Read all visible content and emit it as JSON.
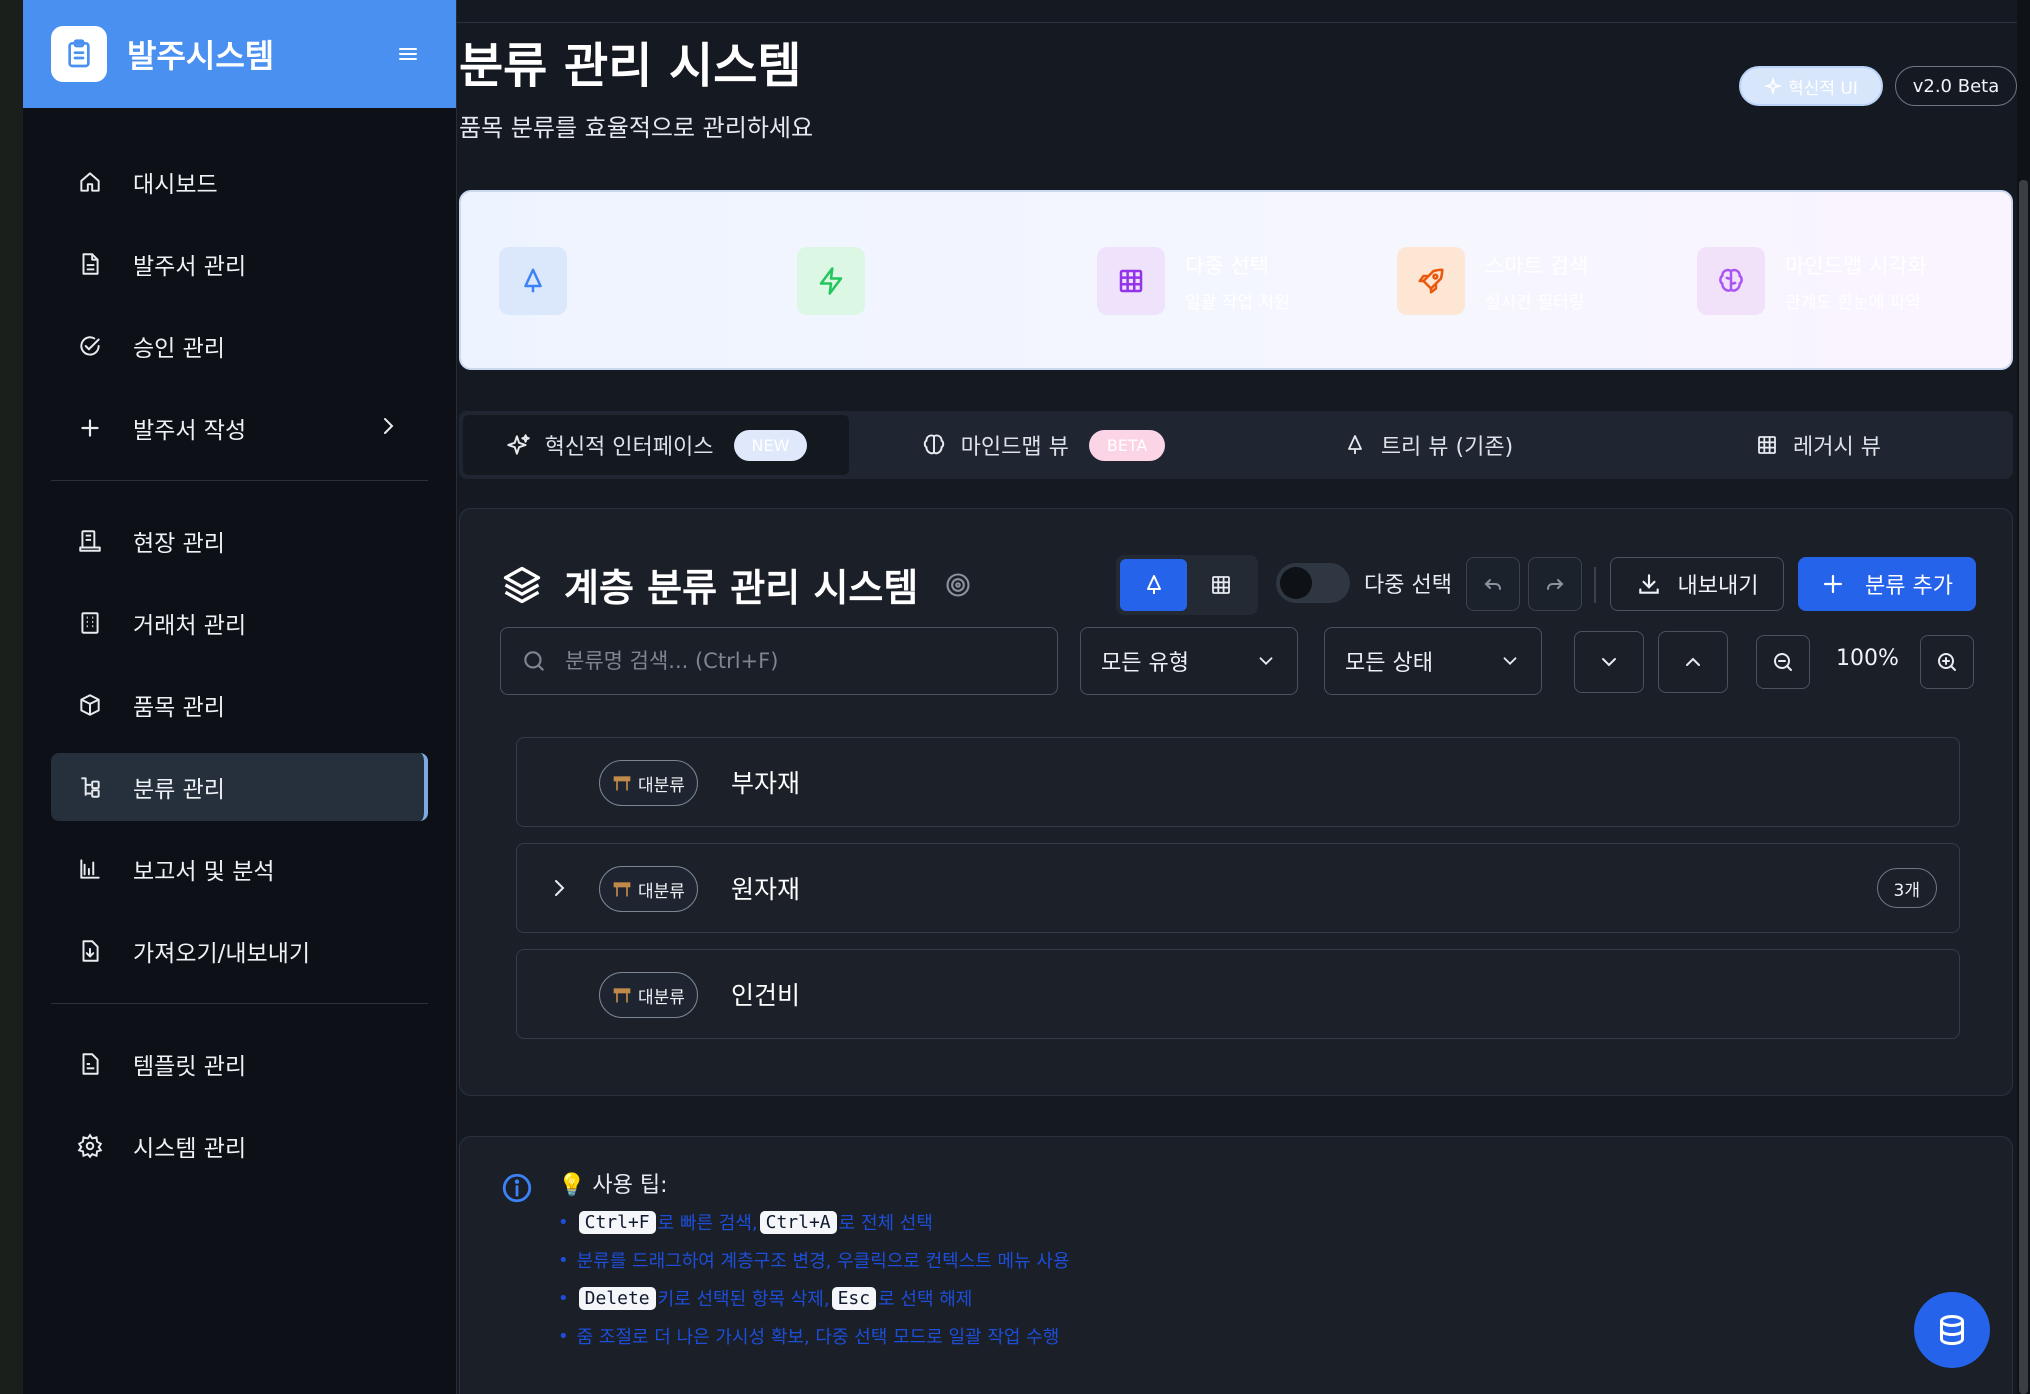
{
  "sidebar": {
    "app_title": "발주시스템",
    "logo_icon": "clipboard-icon",
    "items": [
      {
        "label": "대시보드",
        "icon": "home-icon"
      },
      {
        "label": "발주서 관리",
        "icon": "document-icon"
      },
      {
        "label": "승인 관리",
        "icon": "check-circle-icon"
      },
      {
        "label": "발주서 작성",
        "icon": "plus-icon"
      },
      {
        "label": "현장 관리",
        "icon": "site-icon"
      },
      {
        "label": "거래처 관리",
        "icon": "building-icon"
      },
      {
        "label": "품목 관리",
        "icon": "box-icon"
      },
      {
        "label": "분류 관리",
        "icon": "hierarchy-icon",
        "active": true
      },
      {
        "label": "보고서 및 분석",
        "icon": "bar-chart-icon"
      },
      {
        "label": "가져오기/내보내기",
        "icon": "file-download-icon"
      },
      {
        "label": "템플릿 관리",
        "icon": "template-icon"
      },
      {
        "label": "시스템 관리",
        "icon": "gear-icon"
      }
    ]
  },
  "header": {
    "title": "분류 관리 시스템",
    "subtitle": "품목 분류를 효율적으로 관리하세요",
    "innovative_badge": "혁신적 UI",
    "version_badge": "v2.0 Beta"
  },
  "features": [
    {
      "name": "",
      "desc": "",
      "icon": "tree-icon",
      "color": "#dbe7fb",
      "stroke": "#3b82f6"
    },
    {
      "name": "",
      "desc": "",
      "icon": "lightning-icon",
      "color": "#dcf7e3",
      "stroke": "#22c55e"
    },
    {
      "name": "다중 선택",
      "desc": "일괄 작업 지원",
      "icon": "grid-icon",
      "color": "#efe3fb",
      "stroke": "#9333ea"
    },
    {
      "name": "스마트 검색",
      "desc": "실시간 필터링",
      "icon": "rocket-icon",
      "color": "#fde7d4",
      "stroke": "#ea580c"
    },
    {
      "name": "마인드맵 시각화",
      "desc": "관계도 한눈에 파악",
      "icon": "brain-icon",
      "color": "#f1e2fa",
      "stroke": "#a855f7"
    }
  ],
  "tabs": [
    {
      "label": "혁신적 인터페이스",
      "badge": "NEW",
      "icon": "sparkle-icon"
    },
    {
      "label": "마인드맵 뷰",
      "badge": "BETA",
      "icon": "brain-icon"
    },
    {
      "label": "트리 뷰 (기존)",
      "icon": "tree-icon"
    },
    {
      "label": "레거시 뷰",
      "icon": "grid-icon"
    }
  ],
  "panel": {
    "title": "계층 분류 관리 시스템",
    "multi_select_label": "다중 선택",
    "export_label": "내보내기",
    "add_label": "분류 추가",
    "search_placeholder": "분류명 검색... (Ctrl+F)",
    "type_filter": "모든 유형",
    "status_filter": "모든 상태",
    "zoom_level": "100%"
  },
  "categories": [
    {
      "badge": "대분류",
      "name": "부자재",
      "count": null,
      "expandable": false
    },
    {
      "badge": "대분류",
      "name": "원자재",
      "count": "3개",
      "expandable": true
    },
    {
      "badge": "대분류",
      "name": "인건비",
      "count": null,
      "expandable": false
    }
  ],
  "tips": {
    "title": "💡 사용 팁:",
    "bullet": "•",
    "line1": {
      "k1": "Ctrl+F",
      "t1": "로 빠른 검색, ",
      "k2": "Ctrl+A",
      "t2": "로 전체 선택"
    },
    "line2": "분류를 드래그하여 계층구조 변경, 우클릭으로 컨텍스트 메뉴 사용",
    "line3": {
      "k1": "Delete",
      "t1": "키로 선택된 항목 삭제, ",
      "k2": "Esc",
      "t2": "로 선택 해제"
    },
    "line4": "줌 조절로 더 나은 가시성 확보, 다중 선택 모드로 일괄 작업 수행"
  },
  "colors": {
    "accent": "#2563eb",
    "sidebar_header": "#4a90f0",
    "tip_text": "#1d4ed8"
  }
}
